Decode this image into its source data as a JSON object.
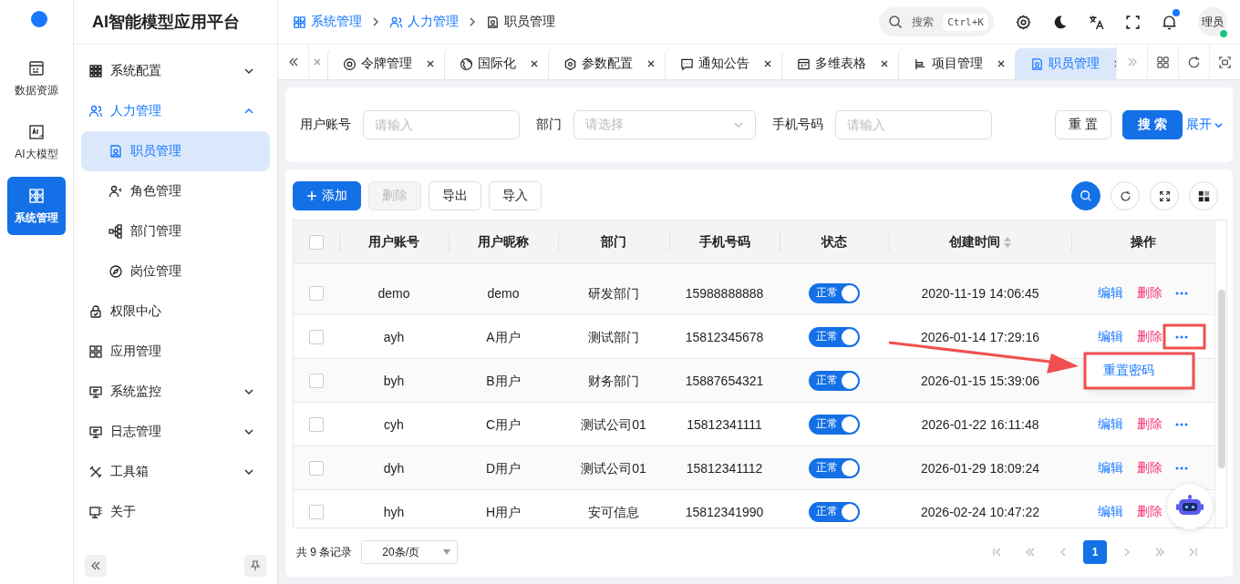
{
  "app": {
    "title": "AI智能模型应用平台"
  },
  "rail": [
    {
      "label": "数据资源",
      "selected": false
    },
    {
      "label": "AI大模型",
      "selected": false
    },
    {
      "label": "系统管理",
      "selected": true
    }
  ],
  "sidebar": {
    "items": [
      {
        "label": "系统配置",
        "selected": false,
        "expanded": false
      },
      {
        "label": "人力管理",
        "selected": false,
        "expanded": true,
        "children": [
          {
            "label": "职员管理",
            "selected": true
          },
          {
            "label": "角色管理",
            "selected": false
          },
          {
            "label": "部门管理",
            "selected": false
          },
          {
            "label": "岗位管理",
            "selected": false
          }
        ]
      },
      {
        "label": "权限中心",
        "selected": false
      },
      {
        "label": "应用管理",
        "selected": false
      },
      {
        "label": "系统监控",
        "selected": false,
        "expanded": false
      },
      {
        "label": "日志管理",
        "selected": false,
        "expanded": false
      },
      {
        "label": "工具箱",
        "selected": false,
        "expanded": false
      },
      {
        "label": "关于",
        "selected": false
      }
    ]
  },
  "breadcrumb": [
    {
      "label": "系统管理",
      "current": false
    },
    {
      "label": "人力管理",
      "current": false
    },
    {
      "label": "职员管理",
      "current": true
    }
  ],
  "header": {
    "search": {
      "placeholder": "搜索",
      "shortcut": "Ctrl+K"
    },
    "notifications": {
      "unread": true
    },
    "avatar": {
      "text": "理员",
      "online": true
    }
  },
  "tabs": [
    {
      "label": "令牌管理",
      "selected": false
    },
    {
      "label": "国际化",
      "selected": false
    },
    {
      "label": "参数配置",
      "selected": false
    },
    {
      "label": "通知公告",
      "selected": false
    },
    {
      "label": "多维表格",
      "selected": false
    },
    {
      "label": "项目管理",
      "selected": false
    },
    {
      "label": "职员管理",
      "selected": true
    }
  ],
  "filters": [
    {
      "label": "用户账号",
      "kind": "input",
      "placeholder": "请输入"
    },
    {
      "label": "部门",
      "kind": "select",
      "placeholder": "请选择"
    },
    {
      "label": "手机号码",
      "kind": "input",
      "placeholder": "请输入"
    }
  ],
  "filter_buttons": {
    "reset": "重 置",
    "search": "搜 索",
    "expand": "展开"
  },
  "toolbar": [
    {
      "label": "添加",
      "kind": "primary",
      "disabled": false
    },
    {
      "label": "删除",
      "kind": "default",
      "disabled": true
    },
    {
      "label": "导出",
      "kind": "default",
      "disabled": false
    },
    {
      "label": "导入",
      "kind": "default",
      "disabled": false
    }
  ],
  "table": {
    "all_checked": false,
    "columns": [
      {
        "label": "用户账号",
        "sortable": false
      },
      {
        "label": "用户昵称",
        "sortable": false
      },
      {
        "label": "部门",
        "sortable": false
      },
      {
        "label": "手机号码",
        "sortable": false
      },
      {
        "label": "状态",
        "sortable": false
      },
      {
        "label": "创建时间",
        "sortable": true
      },
      {
        "label": "操作",
        "sortable": false
      }
    ],
    "rows": [
      {
        "checked": false,
        "account": "demo",
        "nickname": "demo",
        "department": "研发部门",
        "phone": "15988888888",
        "status": {
          "label": "正常",
          "on": true
        },
        "created": "2020-11-19 14:06:45",
        "actions": [
          "编辑",
          "删除"
        ],
        "more_button": true
      },
      {
        "checked": false,
        "account": "ayh",
        "nickname": "A用户",
        "department": "测试部门",
        "phone": "15812345678",
        "status": {
          "label": "正常",
          "on": true
        },
        "created": "2026-01-14 17:29:16",
        "actions": [
          "编辑",
          "删除"
        ],
        "more_button": true
      },
      {
        "checked": false,
        "account": "byh",
        "nickname": "B用户",
        "department": "财务部门",
        "phone": "15887654321",
        "status": {
          "label": "正常",
          "on": true
        },
        "created": "2026-01-15 15:39:06",
        "actions": [],
        "more_button": false
      },
      {
        "checked": false,
        "account": "cyh",
        "nickname": "C用户",
        "department": "测试公司01",
        "phone": "15812341111",
        "status": {
          "label": "正常",
          "on": true
        },
        "created": "2026-01-22 16:11:48",
        "actions": [
          "编辑",
          "删除"
        ],
        "more_button": true
      },
      {
        "checked": false,
        "account": "dyh",
        "nickname": "D用户",
        "department": "测试公司01",
        "phone": "15812341112",
        "status": {
          "label": "正常",
          "on": true
        },
        "created": "2026-01-29 18:09:24",
        "actions": [
          "编辑",
          "删除"
        ],
        "more_button": true
      },
      {
        "checked": false,
        "account": "hyh",
        "nickname": "H用户",
        "department": "安可信息",
        "phone": "15812341990",
        "status": {
          "label": "正常",
          "on": true
        },
        "created": "2026-02-24 10:47:22",
        "actions": [
          "编辑",
          "删除"
        ],
        "more_button": false
      }
    ]
  },
  "row_menu": {
    "items": [
      "重置密码"
    ]
  },
  "pagination": {
    "total": "共 9 条记录",
    "page_size": "20条/页",
    "pages": [
      {
        "label": "1",
        "selected": true
      }
    ]
  },
  "annotations": [
    {
      "kind": "frame"
    },
    {
      "kind": "frame"
    },
    {
      "kind": "arrow"
    }
  ]
}
